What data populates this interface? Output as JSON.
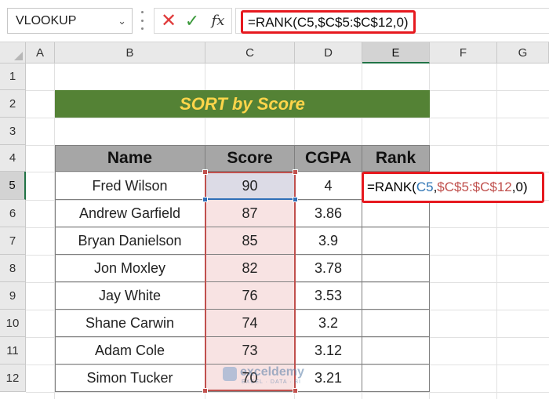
{
  "formula_bar": {
    "name_box": "VLOOKUP",
    "formula": "=RANK(C5,$C$5:$C$12,0)"
  },
  "columns": [
    "A",
    "B",
    "C",
    "D",
    "E",
    "F",
    "G"
  ],
  "rows": [
    "1",
    "2",
    "3",
    "4",
    "5",
    "6",
    "7",
    "8",
    "9",
    "10",
    "11",
    "12"
  ],
  "title": "SORT by Score",
  "table": {
    "headers": [
      "Name",
      "Score",
      "CGPA",
      "Rank"
    ],
    "rows": [
      [
        "Fred Wilson",
        "90",
        "4",
        ""
      ],
      [
        "Andrew Garfield",
        "87",
        "3.86",
        ""
      ],
      [
        "Bryan Danielson",
        "85",
        "3.9",
        ""
      ],
      [
        "Jon Moxley",
        "82",
        "3.78",
        ""
      ],
      [
        "Jay White",
        "76",
        "3.53",
        ""
      ],
      [
        "Shane Carwin",
        "74",
        "3.2",
        ""
      ],
      [
        "Adam Cole",
        "73",
        "3.12",
        ""
      ],
      [
        "Simon Tucker",
        "70",
        "3.21",
        ""
      ]
    ]
  },
  "editing_cell": {
    "prefix": "=RANK(",
    "ref1": "C5",
    "sep": ",",
    "ref2": "$C$5:$C$12",
    "suffix": ",0)"
  },
  "watermark": {
    "name": "exceldemy",
    "tagline": "EXCEL · DATA · BI"
  },
  "colors": {
    "accent_green": "#548235",
    "title_text": "#ffd54a",
    "header_fill": "#a6a6a6",
    "range_red": "#c0504d",
    "ref_blue": "#2f75b5",
    "highlight_red": "#e6191f"
  }
}
